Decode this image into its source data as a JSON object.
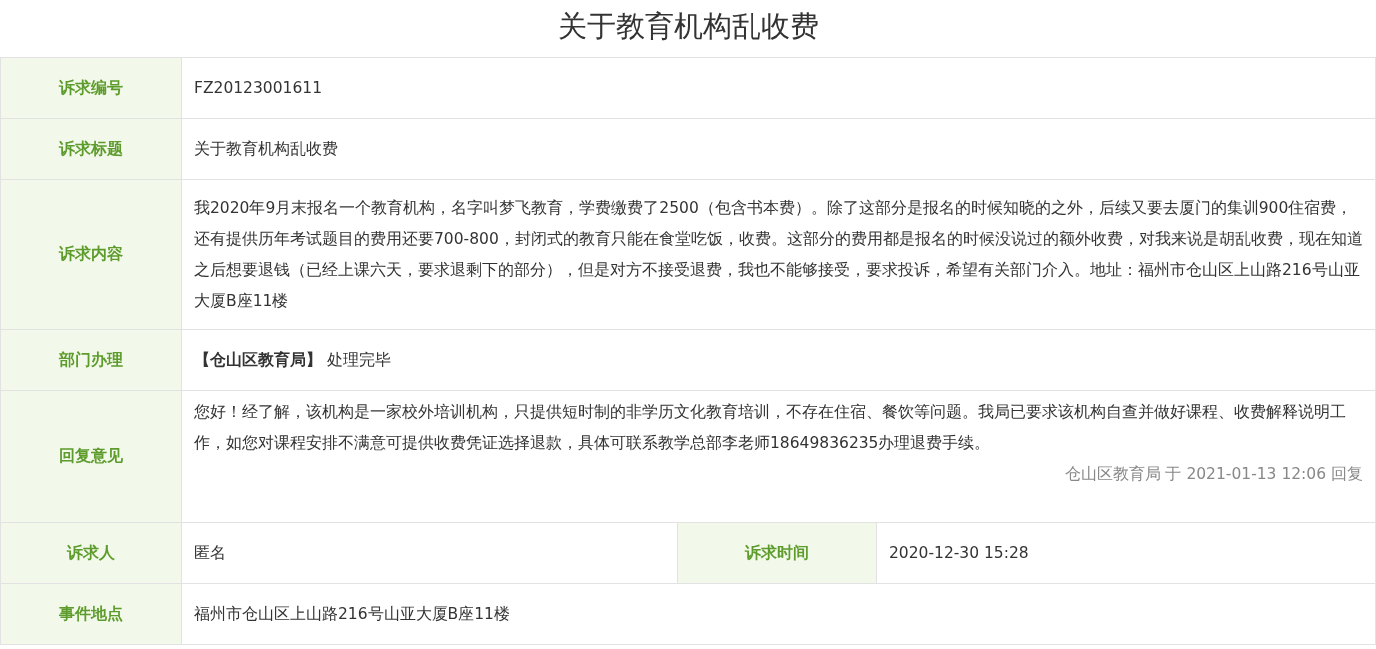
{
  "title": "关于教育机构乱收费",
  "rows": [
    {
      "kind": "text",
      "label": "诉求编号",
      "value": "FZ20123001611"
    },
    {
      "kind": "text",
      "label": "诉求标题",
      "value": "关于教育机构乱收费"
    },
    {
      "kind": "text",
      "label": "诉求内容",
      "value": "我2020年9月末报名一个教育机构，名字叫梦飞教育，学费缴费了2500（包含书本费）。除了这部分是报名的时候知晓的之外，后续又要去厦门的集训900住宿费，还有提供历年考试题目的费用还要700-800，封闭式的教育只能在食堂吃饭，收费。这部分的费用都是报名的时候没说过的额外收费，对我来说是胡乱收费，现在知道之后想要退钱（已经上课六天，要求退剩下的部分），但是对方不接受退费，我也不能够接受，要求投诉，希望有关部门介入。地址：福州市仓山区上山路216号山亚大厦B座11楼"
    },
    {
      "kind": "department",
      "label": "部门办理",
      "department": "【仓山区教育局】",
      "status": "处理完毕"
    },
    {
      "kind": "reply",
      "label": "回复意见",
      "value": "您好！经了解，该机构是一家校外培训机构，只提供短时制的非学历文化教育培训，不存在住宿、餐饮等问题。我局已要求该机构自查并做好课程、收费解释说明工作，如您对课程安排不满意可提供收费凭证选择退款，具体可联系教学总部李老师18649836235办理退费手续。",
      "meta": "仓山区教育局 于 2021-01-13 12:06 回复"
    },
    {
      "kind": "pair",
      "label": "诉求人",
      "value": "匿名",
      "label2": "诉求时间",
      "value2": "2020-12-30 15:28"
    },
    {
      "kind": "text",
      "label": "事件地点",
      "value": "福州市仓山区上山路216号山亚大厦B座11楼"
    }
  ]
}
